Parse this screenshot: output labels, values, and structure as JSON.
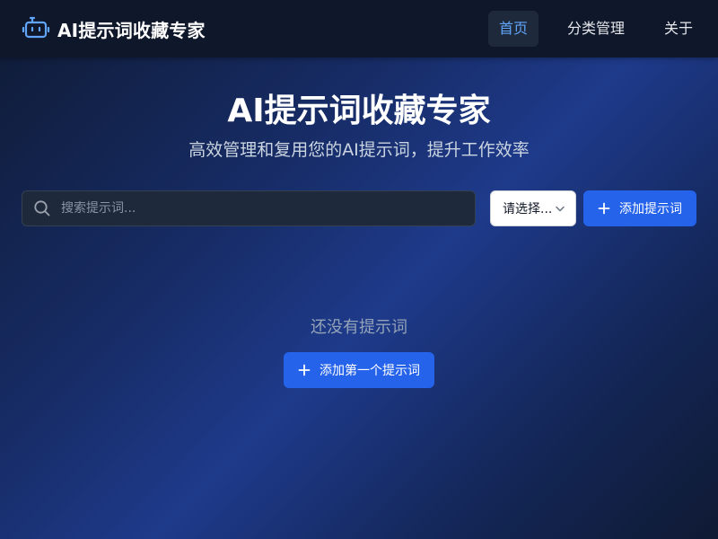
{
  "header": {
    "brand_icon": "robot-icon",
    "brand_title": "AI提示词收藏专家",
    "nav": [
      {
        "label": "首页",
        "active": true
      },
      {
        "label": "分类管理",
        "active": false
      },
      {
        "label": "关于",
        "active": false
      }
    ]
  },
  "hero": {
    "title": "AI提示词收藏专家",
    "subtitle": "高效管理和复用您的AI提示词，提升工作效率"
  },
  "toolbar": {
    "search_icon": "search-icon",
    "search_placeholder": "搜索提示词...",
    "search_value": "",
    "category_select_value": "请选择...",
    "add_button_label": "添加提示词"
  },
  "empty_state": {
    "message": "还没有提示词",
    "button_label": "添加第一个提示词"
  },
  "colors": {
    "accent": "#2563eb",
    "nav_active_text": "#60a5fa",
    "header_bg": "#0f172a",
    "icon_blue": "#60a5fa"
  }
}
